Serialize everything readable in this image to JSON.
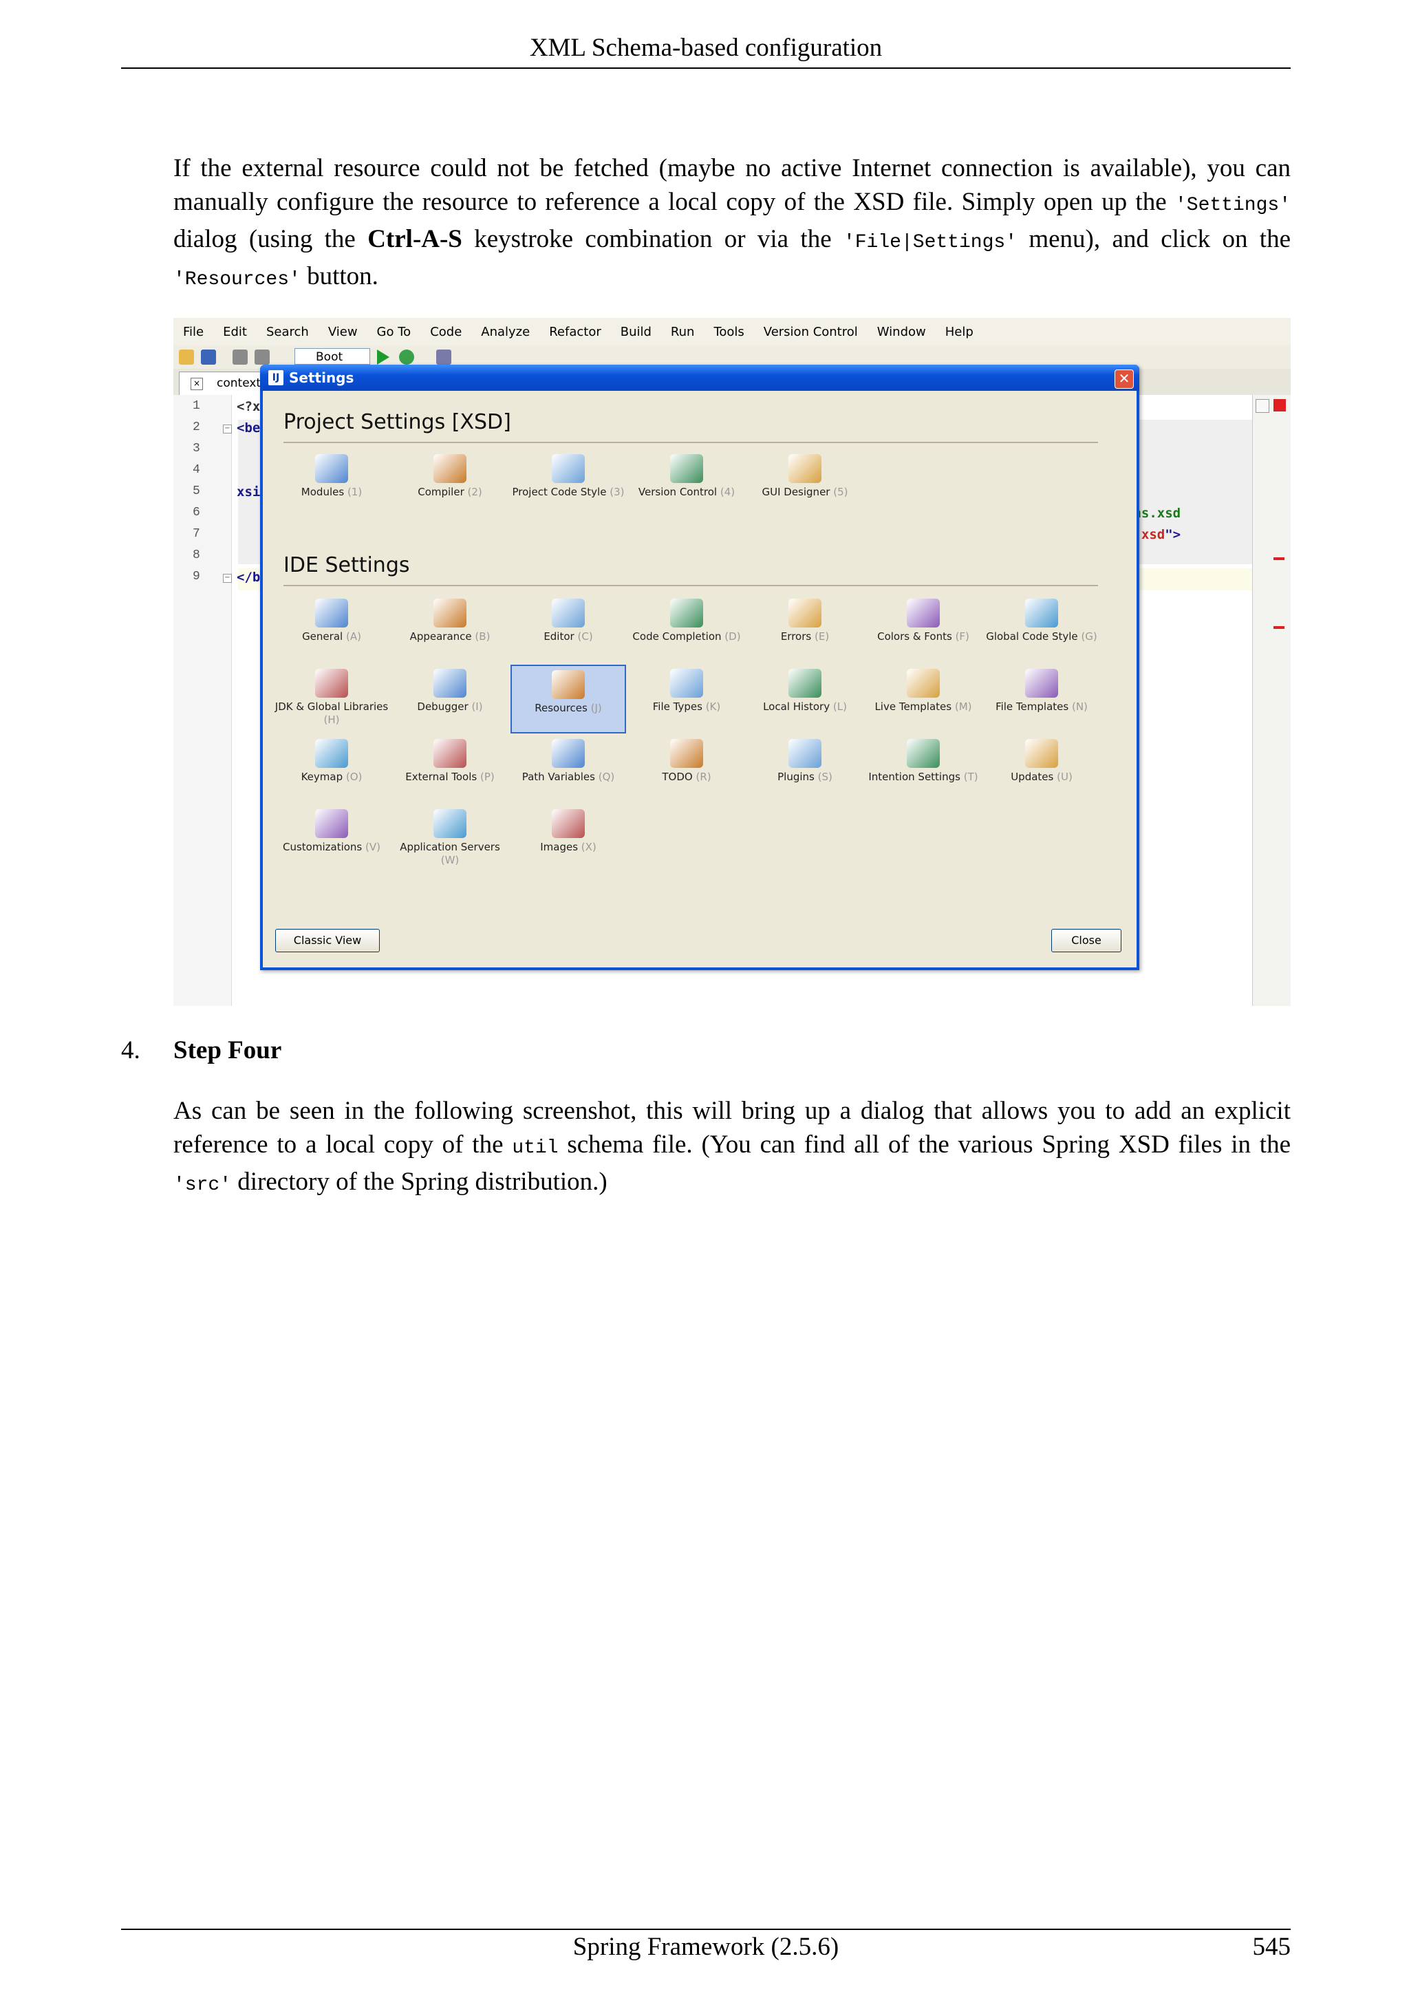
{
  "header": {
    "title": "XML Schema-based configuration"
  },
  "intro": {
    "text1": "If the external resource could not be fetched (maybe no active Internet connection is available), you can manually configure the resource to reference a local copy of the XSD file. Simply open up the ",
    "settings_code": "'Settings'",
    "text2": " dialog (using the ",
    "shortcut": "Ctrl-A-S",
    "text3": " keystroke combination or via the ",
    "menu_code": "'File|Settings'",
    "text4": " menu), and click on the ",
    "resources_code": "'Resources'",
    "text5": " button."
  },
  "ide": {
    "menu": [
      "File",
      "Edit",
      "Search",
      "View",
      "Go To",
      "Code",
      "Analyze",
      "Refactor",
      "Build",
      "Run",
      "Tools",
      "Version Control",
      "Window",
      "Help"
    ],
    "toolbar_combo": "Boot",
    "tab": "context",
    "line_numbers": [
      "1",
      "2",
      "3",
      "4",
      "5",
      "6",
      "7",
      "8",
      "9"
    ],
    "code": {
      "l1": "<?x",
      "l2": "<be",
      "l5": "xsi",
      "l6": "ans.xsd",
      "l7": "l.xsd",
      "l7_tail": "\">",
      "l9": "</b"
    }
  },
  "dialog": {
    "title": "Settings",
    "project_section": "Project Settings [XSD]",
    "project_items": [
      {
        "name": "Modules",
        "key": "(1)"
      },
      {
        "name": "Compiler",
        "key": "(2)"
      },
      {
        "name": "Project Code Style",
        "key": "(3)"
      },
      {
        "name": "Version Control",
        "key": "(4)"
      },
      {
        "name": "GUI Designer",
        "key": "(5)"
      }
    ],
    "ide_section": "IDE Settings",
    "ide_items": [
      {
        "name": "General",
        "key": "(A)"
      },
      {
        "name": "Appearance",
        "key": "(B)"
      },
      {
        "name": "Editor",
        "key": "(C)"
      },
      {
        "name": "Code Completion",
        "key": "(D)"
      },
      {
        "name": "Errors",
        "key": "(E)"
      },
      {
        "name": "Colors & Fonts",
        "key": "(F)"
      },
      {
        "name": "Global Code Style",
        "key": "(G)"
      },
      {
        "name": "JDK & Global Libraries",
        "key": "(H)"
      },
      {
        "name": "Debugger",
        "key": "(I)"
      },
      {
        "name": "Resources",
        "key": "(J)"
      },
      {
        "name": "File Types",
        "key": "(K)"
      },
      {
        "name": "Local History",
        "key": "(L)"
      },
      {
        "name": "Live Templates",
        "key": "(M)"
      },
      {
        "name": "File Templates",
        "key": "(N)"
      },
      {
        "name": "Keymap",
        "key": "(O)"
      },
      {
        "name": "External Tools",
        "key": "(P)"
      },
      {
        "name": "Path Variables",
        "key": "(Q)"
      },
      {
        "name": "TODO",
        "key": "(R)"
      },
      {
        "name": "Plugins",
        "key": "(S)"
      },
      {
        "name": "Intention Settings",
        "key": "(T)"
      },
      {
        "name": "Updates",
        "key": "(U)"
      },
      {
        "name": "Customizations",
        "key": "(V)"
      },
      {
        "name": "Application Servers",
        "key": "(W)"
      },
      {
        "name": "Images",
        "key": "(X)"
      }
    ],
    "classic_view_button": "Classic View",
    "close_button": "Close"
  },
  "step": {
    "number": "4.",
    "title": "Step Four"
  },
  "step_text": {
    "text1": "As can be seen in the following screenshot, this will bring up a dialog that allows you to add an explicit reference to a local copy of the ",
    "util_code": "util",
    "text2": " schema file. (You can find all of the various Spring XSD files in the ",
    "src_code": "'src'",
    "text3": " directory of the Spring distribution.)"
  },
  "footer": {
    "title": "Spring Framework (2.5.6)",
    "page": "545"
  },
  "colors": {
    "title_bar": "#0a52d8",
    "dialog_bg": "#ece9d8",
    "selected_tile": "#c1d2ee"
  }
}
